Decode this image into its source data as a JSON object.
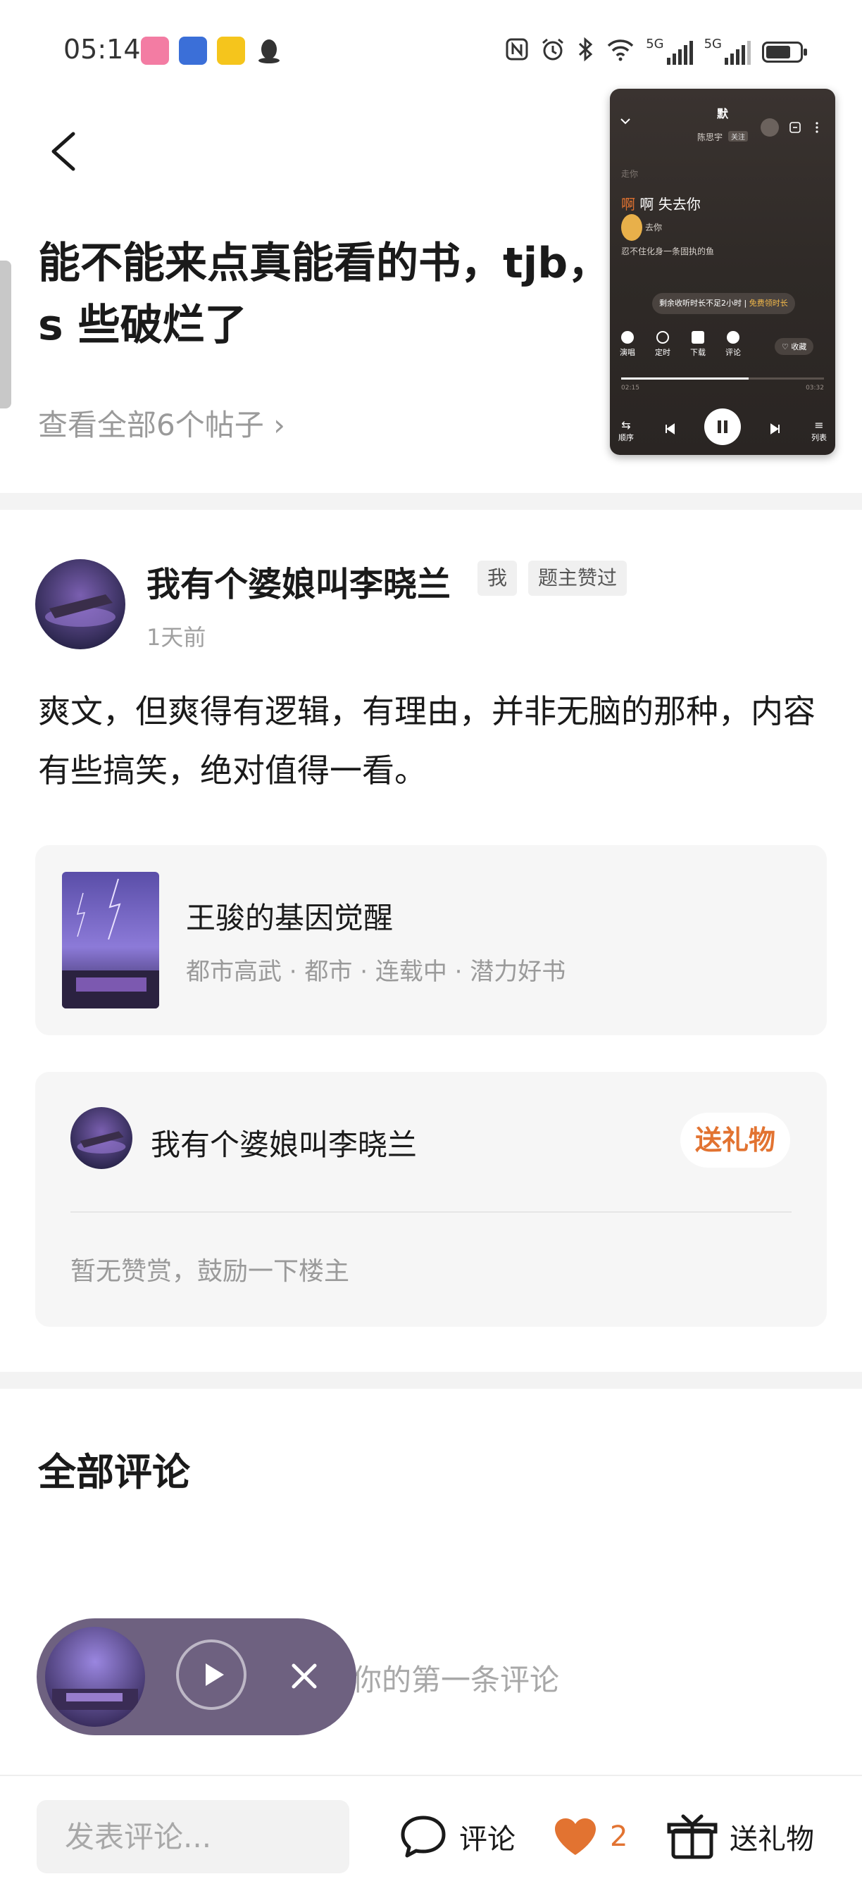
{
  "status_bar": {
    "time": "05:14",
    "net1": "5G",
    "net2": "5G"
  },
  "header": {
    "title": "能不能来点真能看的书，tjb，s 些破烂了",
    "view_all": "查看全部6个帖子 ›"
  },
  "mini_player": {
    "song_title": "默",
    "artist": "陈思宇",
    "artist_tag": "关注",
    "lyric_faded": "走你",
    "lyric_active": "啊 失去你",
    "lyric_next": "去你",
    "lyric_next2": "忍不住化身一条固执的鱼",
    "promo": "剩余收听时长不足2小时",
    "promo_link": "免费领时长",
    "actions": [
      "演唱",
      "定时",
      "下载",
      "评论"
    ],
    "collect": "收藏",
    "time_start": "02:15",
    "time_end": "03:32",
    "mode": "顺序",
    "list": "列表",
    "progress": 0.63
  },
  "post": {
    "author": "我有个婆娘叫李晓兰",
    "tag_me": "我",
    "tag_liked": "题主赞过",
    "time": "1天前",
    "body": "爽文，但爽得有逻辑，有理由，并非无脑的那种，内容有些搞笑，绝对值得一看。"
  },
  "book": {
    "title": "王骏的基因觉醒",
    "meta": "都市高武 · 都市 · 连载中 · 潜力好书"
  },
  "reward": {
    "name": "我有个婆娘叫李晓兰",
    "gift_button": "送礼物",
    "empty_text": "暂无赞赏，鼓励一下楼主"
  },
  "comments": {
    "title": "全部评论",
    "empty_hint": "你的第一条评论"
  },
  "bottom_bar": {
    "input_placeholder": "发表评论...",
    "comment_label": "评论",
    "like_count": "2",
    "gift_label": "送礼物"
  },
  "colors": {
    "accent": "#e27331",
    "pill_bg": "#6e6180"
  }
}
